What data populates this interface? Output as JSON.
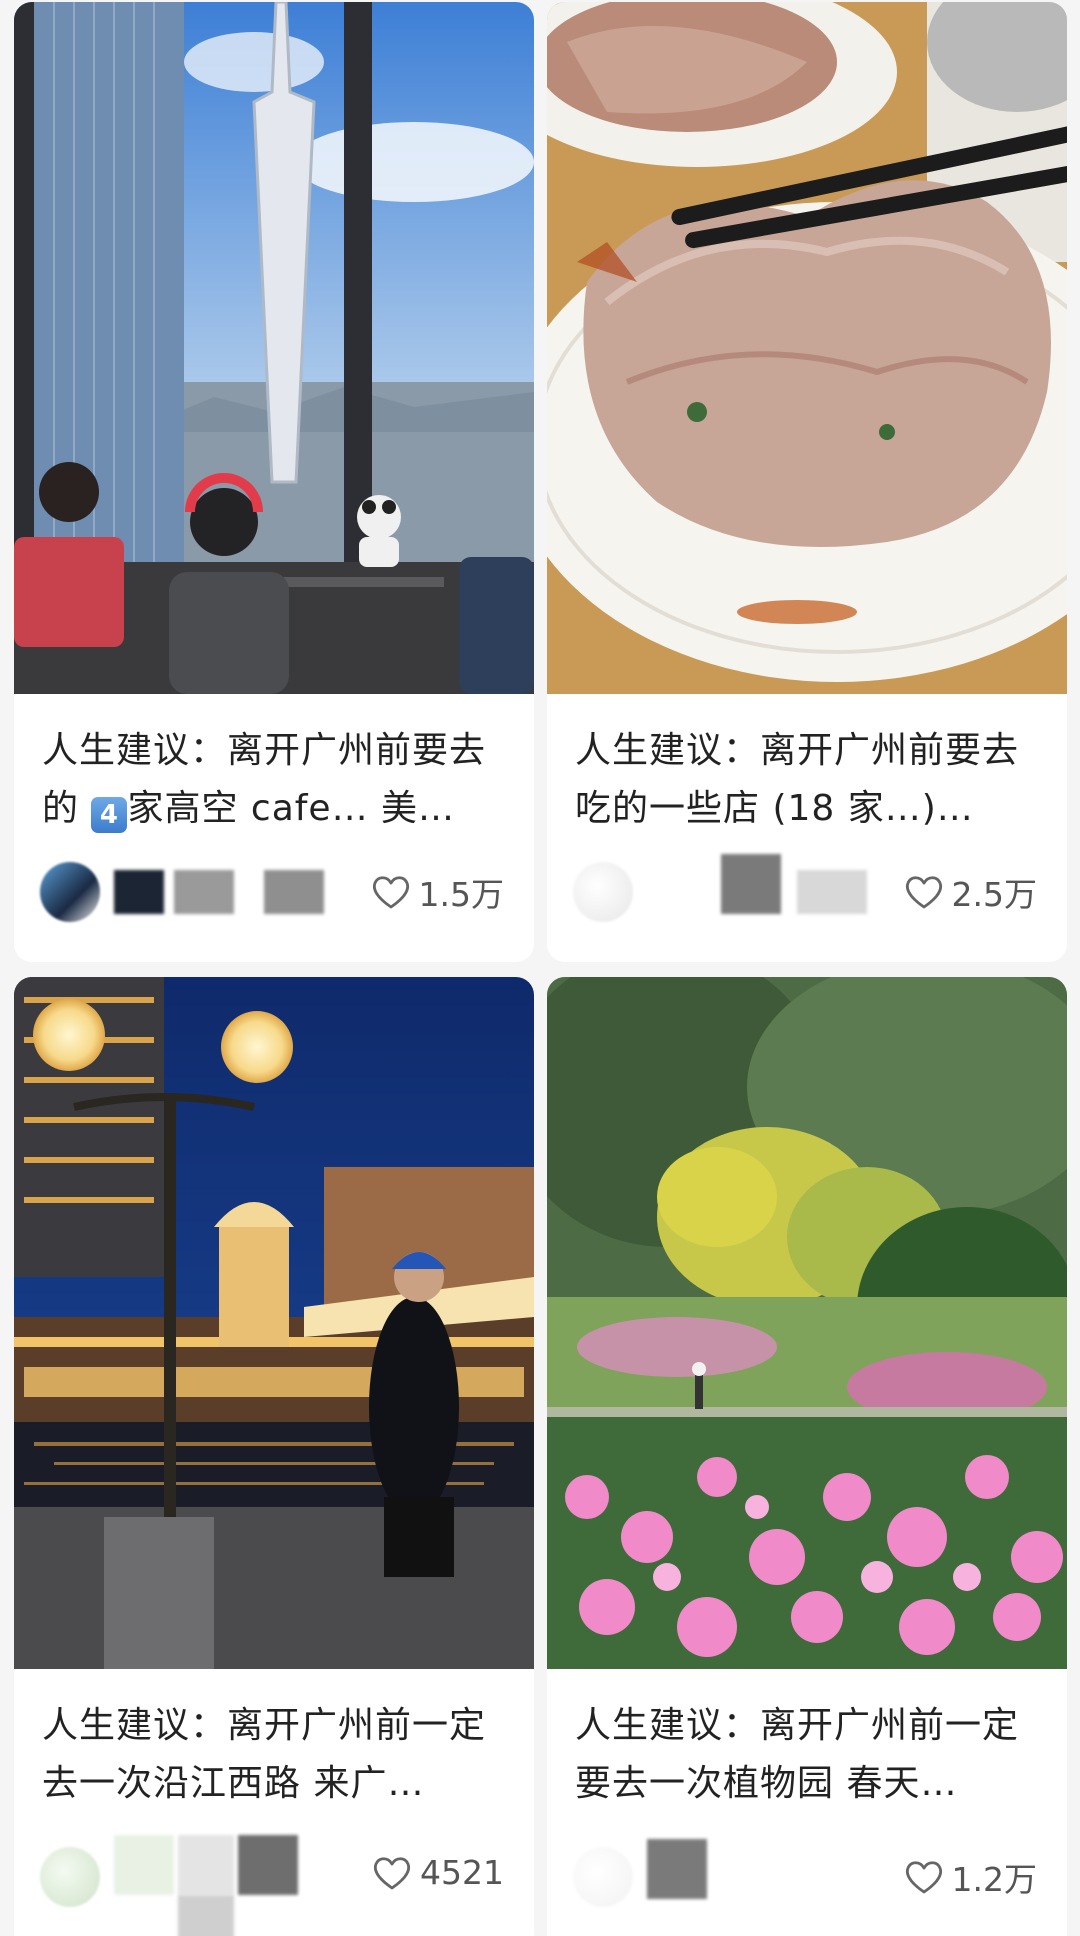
{
  "cards": [
    {
      "title_a": "人生建议：离开广州前要去的 ",
      "title_badge": "4",
      "title_b": "家高空 cafe… 美…",
      "likes": "1.5万",
      "cover": "Canton Tower view from high-rise cafe window"
    },
    {
      "title": "人生建议：离开广州前要去吃的一些店 (18 家…)…",
      "likes": "2.5万",
      "cover": "Rice noodle roll (cheung fun) held with chopsticks"
    },
    {
      "title": "人生建议：离开广州前一定去一次沿江西路 来广…",
      "likes": "4521",
      "cover": "Night riverside with street lamps and domed building"
    },
    {
      "title": "人生建议：离开广州前一定要去一次植物园 春天…",
      "likes": "1.2万",
      "cover": "Botanical garden with pink azaleas and yellow trees"
    }
  ],
  "colors": {
    "background": "#f5f5f5",
    "card": "#ffffff",
    "title_text": "#222222",
    "meta_text": "#555555"
  },
  "icons": {
    "like": "heart-outline-icon"
  }
}
